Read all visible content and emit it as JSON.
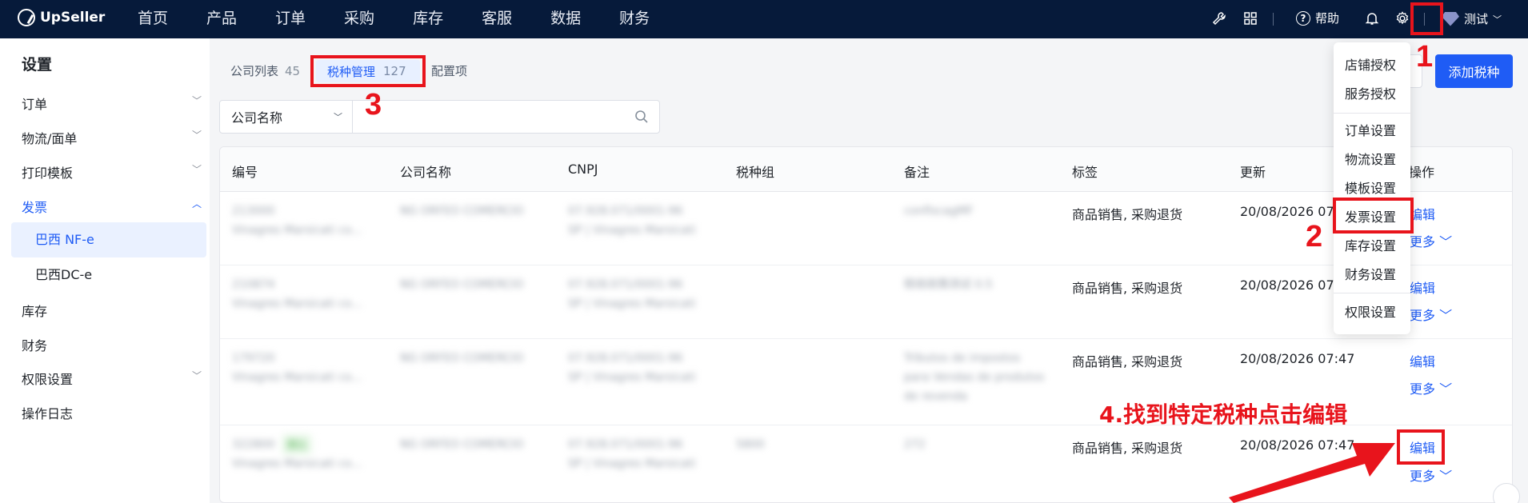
{
  "brand": {
    "name": "UpSeller"
  },
  "nav": [
    "首页",
    "产品",
    "订单",
    "采购",
    "库存",
    "客服",
    "数据",
    "财务"
  ],
  "topbar": {
    "help": "帮助",
    "user": "测试"
  },
  "sidebar": {
    "title": "设置",
    "items": [
      {
        "label": "订单",
        "chev": "﹀"
      },
      {
        "label": "物流/面单",
        "chev": "﹀"
      },
      {
        "label": "打印模板",
        "chev": "﹀"
      },
      {
        "label": "发票",
        "chev": "︿"
      },
      {
        "label": "库存",
        "chev": ""
      },
      {
        "label": "财务",
        "chev": ""
      },
      {
        "label": "权限设置",
        "chev": "﹀"
      },
      {
        "label": "操作日志",
        "chev": ""
      }
    ],
    "subitems": [
      "巴西 NF-e",
      "巴西DC-e"
    ]
  },
  "tabs": [
    {
      "label": "公司列表",
      "count": "45"
    },
    {
      "label": "税种管理",
      "count": "127"
    },
    {
      "label": "配置项",
      "count": ""
    }
  ],
  "search": {
    "select": "公司名称",
    "placeholder": ""
  },
  "add_button": "添加税种",
  "table": {
    "headers": [
      "编号",
      "公司名称",
      "CNPJ",
      "税种组",
      "备注",
      "标签",
      "更新",
      "操作"
    ],
    "rows": [
      {
        "id": "213000",
        "id2": "Vinagres Marsicati co...",
        "company": "NG ORFEO COMERCIO",
        "cnpj": "07.928.071/0001-96",
        "cnpj2": "SP | Vinagres Marsicati",
        "group": "",
        "note": "confiscagMF",
        "note2": "",
        "note3": "",
        "tags": "商品销售, 采购退货",
        "updated": "20/08/2026 07:4",
        "edit": "编辑",
        "more": "更多 ﹀"
      },
      {
        "id": "210874",
        "id2": "Vinagres Marsicati co...",
        "company": "NG ORFEO COMERCIO",
        "cnpj": "07.928.071/0001-96",
        "cnpj2": "SP | Vinagres Marsicati",
        "group": "",
        "note": "税收政策测试 0.5",
        "note2": "",
        "note3": "",
        "tags": "商品销售, 采购退货",
        "updated": "20/08/2026 07:4",
        "edit": "编辑",
        "more": "更多 ﹀"
      },
      {
        "id": "179720",
        "id2": "Vinagres Marsicati co...",
        "company": "NG ORFEO COMERCIO",
        "cnpj": "07.928.071/0001-96",
        "cnpj2": "SP | Vinagres Marsicati",
        "group": "",
        "note": "Tributos de impostos",
        "note2": "para Vendas de produtos",
        "note3": "de revenda",
        "tags": "商品销售, 采购退货",
        "updated": "20/08/2026 07:47",
        "edit": "编辑",
        "more": "更多 ﹀"
      },
      {
        "id": "322800",
        "id2": "Vinagres Marsicati co...",
        "company": "NG ORFEO COMERCIO",
        "cnpj": "07.928.071/0001-96",
        "cnpj2": "SP | Vinagres Marsicati",
        "group": "5800",
        "note": "272",
        "note2": "",
        "note3": "",
        "tags": "商品销售, 采购退货",
        "updated": "20/08/2026 07:47",
        "edit": "编辑",
        "more": "更多 ﹀",
        "badge": "默认"
      }
    ]
  },
  "dropdown": [
    "店铺授权",
    "服务授权",
    "订单设置",
    "物流设置",
    "模板设置",
    "发票设置",
    "库存设置",
    "财务设置",
    "权限设置"
  ],
  "annotations": {
    "n1": "1",
    "n2": "2",
    "n3": "3",
    "step4": "4.找到特定税种点击编辑",
    "color": "#e8141c"
  },
  "colors": {
    "topbar": "#061a3a",
    "accent": "#1f5cf5"
  }
}
